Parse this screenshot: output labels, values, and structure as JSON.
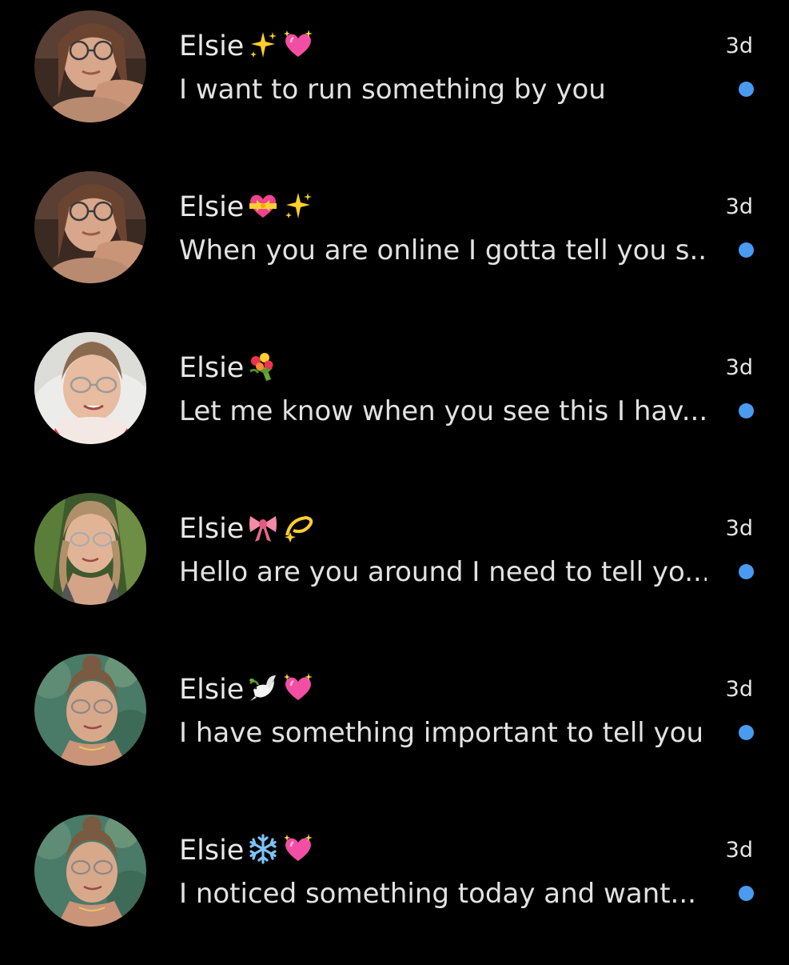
{
  "theme": {
    "background": "#000000",
    "unread_color": "#4a9bf0"
  },
  "conversations": [
    {
      "name": "Elsie",
      "emojis": [
        "sparkles-icon",
        "sparkling-heart-icon"
      ],
      "preview": "I want to run something by you",
      "time": "3d",
      "unread": true
    },
    {
      "name": "Elsie",
      "emojis": [
        "heart-with-ribbon-icon",
        "sparkles-icon"
      ],
      "preview": "When you are online I gotta tell you s...",
      "time": "3d",
      "unread": true
    },
    {
      "name": "Elsie",
      "emojis": [
        "bouquet-icon"
      ],
      "preview": "Let me know when you see this I hav...",
      "time": "3d",
      "unread": true
    },
    {
      "name": "Elsie",
      "emojis": [
        "ribbon-bow-icon",
        "dizzy-icon"
      ],
      "preview": "Hello are you around I need to tell yo...",
      "time": "3d",
      "unread": true
    },
    {
      "name": "Elsie",
      "emojis": [
        "dove-icon",
        "sparkling-heart-icon"
      ],
      "preview": "I have something important to tell you",
      "time": "3d",
      "unread": true
    },
    {
      "name": "Elsie",
      "emojis": [
        "snowflake-icon",
        "sparkling-heart-icon"
      ],
      "preview": "I noticed something today and want...",
      "time": "3d",
      "unread": true
    }
  ]
}
